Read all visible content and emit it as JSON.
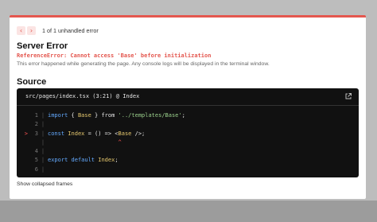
{
  "pagination": {
    "text": "1 of 1 unhandled error",
    "prev_icon": "‹",
    "next_icon": "›"
  },
  "title": "Server Error",
  "error_message": "ReferenceError: Cannot access 'Base' before initialization",
  "help_text": "This error happened while generating the page. Any console logs will be displayed in the terminal window.",
  "source": {
    "heading": "Source",
    "file": "src/pages/index.tsx (3:21) @ Index",
    "lines": [
      {
        "marker": "",
        "num": "1",
        "tokens": [
          {
            "t": "import",
            "c": "kw"
          },
          {
            "t": " { ",
            "c": "op"
          },
          {
            "t": "Base",
            "c": "id"
          },
          {
            "t": " } from ",
            "c": "op"
          },
          {
            "t": "'../templates/Base'",
            "c": "str"
          },
          {
            "t": ";",
            "c": "op"
          }
        ]
      },
      {
        "marker": "",
        "num": "2",
        "tokens": []
      },
      {
        "marker": ">",
        "num": "3",
        "tokens": [
          {
            "t": "const",
            "c": "kw"
          },
          {
            "t": " ",
            "c": "op"
          },
          {
            "t": "Index",
            "c": "id"
          },
          {
            "t": " = () => <",
            "c": "op"
          },
          {
            "t": "Base",
            "c": "id"
          },
          {
            "t": " />;",
            "c": "op"
          }
        ]
      },
      {
        "marker": "",
        "num": "",
        "tokens": [
          {
            "t": "                     ^",
            "c": "caret"
          }
        ]
      },
      {
        "marker": "",
        "num": "4",
        "tokens": []
      },
      {
        "marker": "",
        "num": "5",
        "tokens": [
          {
            "t": "export",
            "c": "kw"
          },
          {
            "t": " ",
            "c": "op"
          },
          {
            "t": "default",
            "c": "kw"
          },
          {
            "t": " ",
            "c": "op"
          },
          {
            "t": "Index",
            "c": "id"
          },
          {
            "t": ";",
            "c": "op"
          }
        ]
      },
      {
        "marker": "",
        "num": "6",
        "tokens": []
      }
    ]
  },
  "show_collapsed": "Show collapsed frames",
  "colors": {
    "accent": "#e4574f",
    "code_bg": "#111111"
  }
}
